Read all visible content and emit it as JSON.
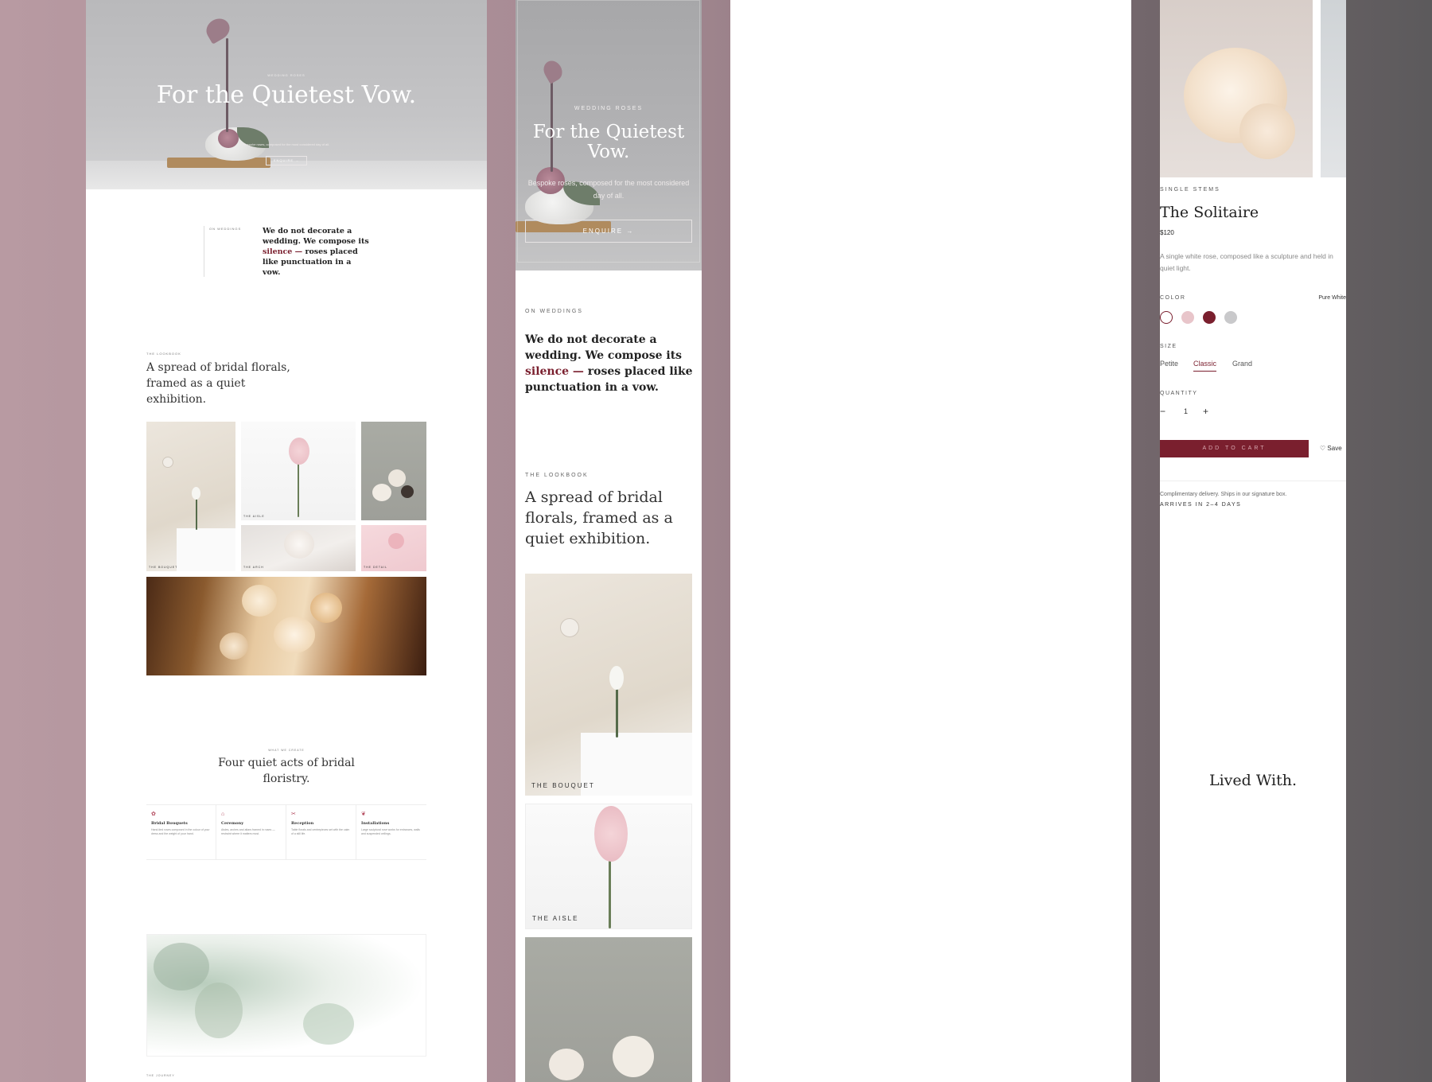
{
  "desktop_home": {
    "hero": {
      "eyebrow": "WEDDING ROSES",
      "title": "For the Quietest Vow.",
      "subtitle": "Bespoke roses, composed for the most considered day of all.",
      "cta": "ENQUIRE →"
    },
    "on_weddings": {
      "label": "ON WEDDINGS",
      "text_before": "We do not decorate a wedding. We compose its ",
      "accent": "silence —",
      "text_after": " roses placed like punctuation in a vow."
    },
    "lookbook": {
      "label": "THE LOOKBOOK",
      "title": "A spread of bridal florals, framed as a quiet exhibition.",
      "captions": [
        "THE BOUQUET",
        "THE AISLE",
        "THE ARCH",
        "THE DETAIL"
      ]
    },
    "what_we_create": {
      "label": "WHAT WE CREATE",
      "title": "Four quiet acts of bridal floristry.",
      "services": [
        {
          "icon": "✿",
          "name": "Bridal Bouquets",
          "desc": "Hand-tied roses composed in the colour of your dress and the weight of your hand."
        },
        {
          "icon": "⌂",
          "name": "Ceremony",
          "desc": "Aisles, arches and altars framed in roses — restraint where it matters most."
        },
        {
          "icon": "✂",
          "name": "Reception",
          "desc": "Table florals and centrepieces set with the calm of a still life."
        },
        {
          "icon": "❦",
          "name": "Installations",
          "desc": "Large sculptural rose works for entrances, walls and suspended ceilings."
        }
      ]
    },
    "journey_label": "THE JOURNEY"
  },
  "mobile_home": {
    "hero": {
      "eyebrow": "WEDDING ROSES",
      "title": "For the Quietest Vow.",
      "subtitle": "Bespoke roses, composed for the most considered day of all.",
      "cta": "ENQUIRE →"
    },
    "on_weddings": {
      "label": "ON WEDDINGS",
      "text_before": "We do not decorate a wedding. We compose its ",
      "accent": "silence —",
      "text_after": " roses placed like punctuation in a vow."
    },
    "lookbook": {
      "label": "THE LOOKBOOK",
      "title": "A spread of bridal florals, framed as a quiet exhibition.",
      "captions": [
        "THE BOUQUET",
        "THE AISLE"
      ]
    }
  },
  "product": {
    "eyebrow": "SINGLE STEMS",
    "title": "The Solitaire",
    "price": "$120",
    "description": "A single white rose, composed like a sculpture and held in quiet light.",
    "color_label": "COLOR",
    "color_value": "Pure White",
    "swatches": [
      "#ffffff",
      "#e8c5ca",
      "#7a1f2e",
      "#c9c9cb"
    ],
    "size_label": "SIZE",
    "sizes": [
      "Petite",
      "Classic",
      "Grand"
    ],
    "quantity_label": "QUANTITY",
    "quantity_minus": "−",
    "quantity_value": "1",
    "quantity_plus": "+",
    "add_to_cart": "ADD TO CART",
    "save": "Save",
    "shipping": "Complimentary delivery. Ships in our signature box.",
    "arrives": "ARRIVES IN 2–4 DAYS",
    "lived_with": "Lived With."
  },
  "colors": {
    "accent": "#7a1f2e",
    "icon_rose": "#b2455a"
  }
}
